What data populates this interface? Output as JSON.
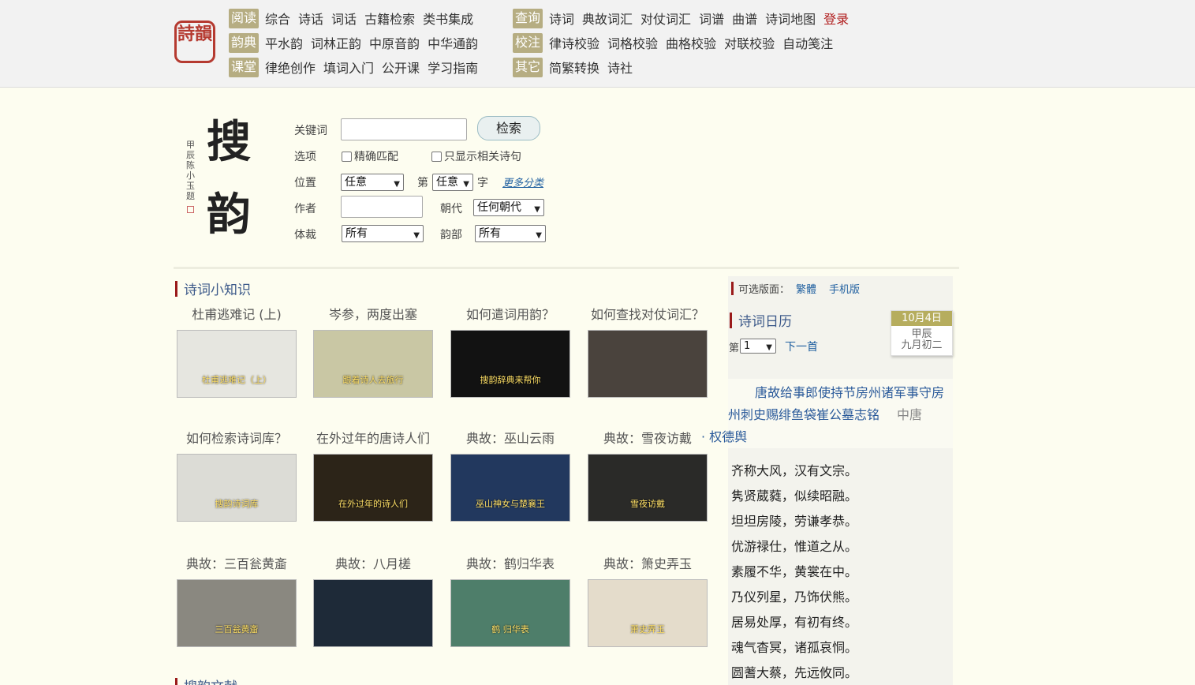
{
  "logo": {
    "text": "詩韻"
  },
  "nav": {
    "rows": [
      {
        "tag": "阅读",
        "links": [
          "综合",
          "诗话",
          "词话",
          "古籍检索",
          "类书集成"
        ]
      },
      {
        "tag": "韵典",
        "links": [
          "平水韵",
          "词林正韵",
          "中原音韵",
          "中华通韵"
        ]
      },
      {
        "tag": "课堂",
        "links": [
          "律绝创作",
          "填词入门",
          "公开课",
          "学习指南"
        ]
      }
    ],
    "rows2": [
      {
        "tag": "查询",
        "links": [
          "诗词",
          "典故词汇",
          "对仗词汇",
          "词谱",
          "曲谱",
          "诗词地图"
        ],
        "login": "登录"
      },
      {
        "tag": "校注",
        "links": [
          "律诗校验",
          "词格校验",
          "曲格校验",
          "对联校验",
          "自动笺注"
        ]
      },
      {
        "tag": "其它",
        "links": [
          "简繁转换",
          "诗社"
        ]
      }
    ]
  },
  "search": {
    "calligraphy_big": [
      "搜",
      "韵"
    ],
    "calligraphy_small": "甲辰陈小玉题",
    "keyword_label": "关键词",
    "keyword_value": "",
    "search_button": "检索",
    "options_label": "选项",
    "exact_match": "精确匹配",
    "related_only": "只显示相关诗句",
    "position_label": "位置",
    "position_value": "任意",
    "nth_label": "第",
    "nth_value": "任意",
    "char_label": "字",
    "more_categories": "更多分类",
    "author_label": "作者",
    "author_value": "",
    "dynasty_label": "朝代",
    "dynasty_value": "任何朝代",
    "genre_label": "体裁",
    "genre_value": "所有",
    "rhyme_label": "韵部",
    "rhyme_value": "所有"
  },
  "knowledge": {
    "title": "诗词小知识",
    "cards": [
      {
        "title": "杜甫逃难记 (上)",
        "caption": "杜甫逃难记（上）",
        "color": "#e6e6e0"
      },
      {
        "title": "岑参，两度出塞",
        "caption": "跟着诗人去旅行",
        "color": "#c9c7a4"
      },
      {
        "title": "如何遣词用韵？",
        "caption": "搜韵辞典来帮你",
        "color": "#121212"
      },
      {
        "title": "如何查找对仗词汇？",
        "caption": "",
        "color": "#4a433d"
      },
      {
        "title": "如何检索诗词库？",
        "caption": "搜韵诗词库",
        "color": "#dcdcd6"
      },
      {
        "title": "在外过年的唐诗人们",
        "caption": "在外过年的诗人们",
        "color": "#2c2418"
      },
      {
        "title": "典故：巫山云雨",
        "caption": "巫山神女与楚襄王",
        "color": "#22385e"
      },
      {
        "title": "典故：雪夜访戴",
        "caption": "雪夜访戴",
        "color": "#2a2a28"
      },
      {
        "title": "典故：三百瓮黄齑",
        "caption": "三百瓮黄齑",
        "color": "#8a8880"
      },
      {
        "title": "典故：八月槎",
        "caption": "",
        "color": "#1e2a38"
      },
      {
        "title": "典故：鹤归华表",
        "caption": "鹤 归华表",
        "color": "#4e7e6a"
      },
      {
        "title": "典故：箫史弄玉",
        "caption": "萧史弄玉",
        "color": "#e4dccb"
      }
    ],
    "next_section_title": "搜韵文献"
  },
  "right": {
    "versions_label": "可选版面：",
    "trad_link": "繁體",
    "mobile_link": "手机版",
    "calendar_title": "诗词日历",
    "date": "10月4日",
    "ganzhi": "甲辰",
    "lunar": "九月初二",
    "nth_prefix": "第",
    "nth_value": "1",
    "next_poem": "下一首",
    "poem_title": "唐故给事郎使持节房州诸军事守房州刺史赐绯鱼袋崔公墓志铭",
    "poem_era": "中唐",
    "poem_author": "· 权德舆",
    "poem_lines": [
      "齐称大风，汉有文宗。",
      "隽贤葳蕤，似续昭融。",
      "坦坦房陵，劳谦孝恭。",
      "优游禄仕，惟道之从。",
      "素履不华，黄裳在中。",
      "乃仪列星，乃饰伏熊。",
      "居易处厚，有初有终。",
      "魂气杳冥，诸孤哀恫。",
      "圆蓍大蔡，先远攸同。"
    ]
  }
}
